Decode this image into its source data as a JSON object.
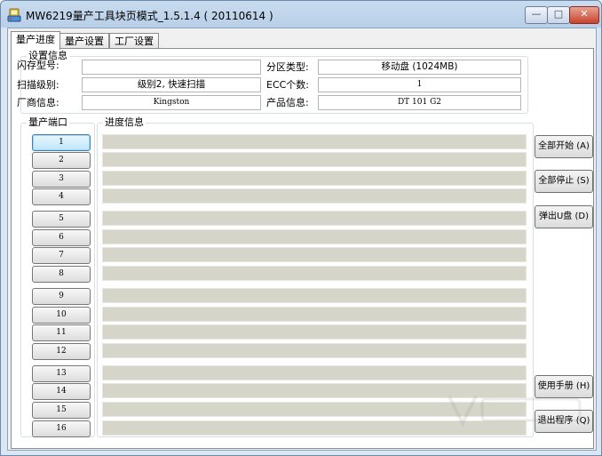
{
  "window": {
    "title": "MW6219量产工具块页模式_1.5.1.4 ( 20110614 )",
    "controls": {
      "minimize": "—",
      "maximize": "□",
      "close": "✕"
    }
  },
  "tabs": [
    "量产进度",
    "量产设置",
    "工厂设置"
  ],
  "settings": {
    "group_title": "设置信息",
    "flash_model_label": "闪存型号:",
    "flash_model_value": "",
    "partition_type_label": "分区类型:",
    "partition_type_value": "移动盘 (1024MB)",
    "scan_level_label": "扫描级别:",
    "scan_level_value": "级别2, 快速扫描",
    "ecc_label": "ECC个数:",
    "ecc_value": "1",
    "vendor_label": "厂商信息:",
    "vendor_value": "Kingston",
    "product_label": "产品信息:",
    "product_value": "DT 101 G2"
  },
  "ports": {
    "group_title": "量产端口",
    "items": [
      "1",
      "2",
      "3",
      "4",
      "5",
      "6",
      "7",
      "8",
      "9",
      "10",
      "11",
      "12",
      "13",
      "14",
      "15",
      "16"
    ]
  },
  "progress": {
    "group_title": "进度信息"
  },
  "actions": {
    "start_all": "全部开始 (A)",
    "stop_all": "全部停止 (S)",
    "eject": "弹出U盘 (D)",
    "manual": "使用手册 (H)",
    "exit": "退出程序 (Q)"
  },
  "colors": {
    "progress_fill": "#d5d5c9",
    "title_gradient_top": "#c9dcef",
    "close_button": "#c7442d",
    "focus_blue": "#3c7fb1"
  }
}
